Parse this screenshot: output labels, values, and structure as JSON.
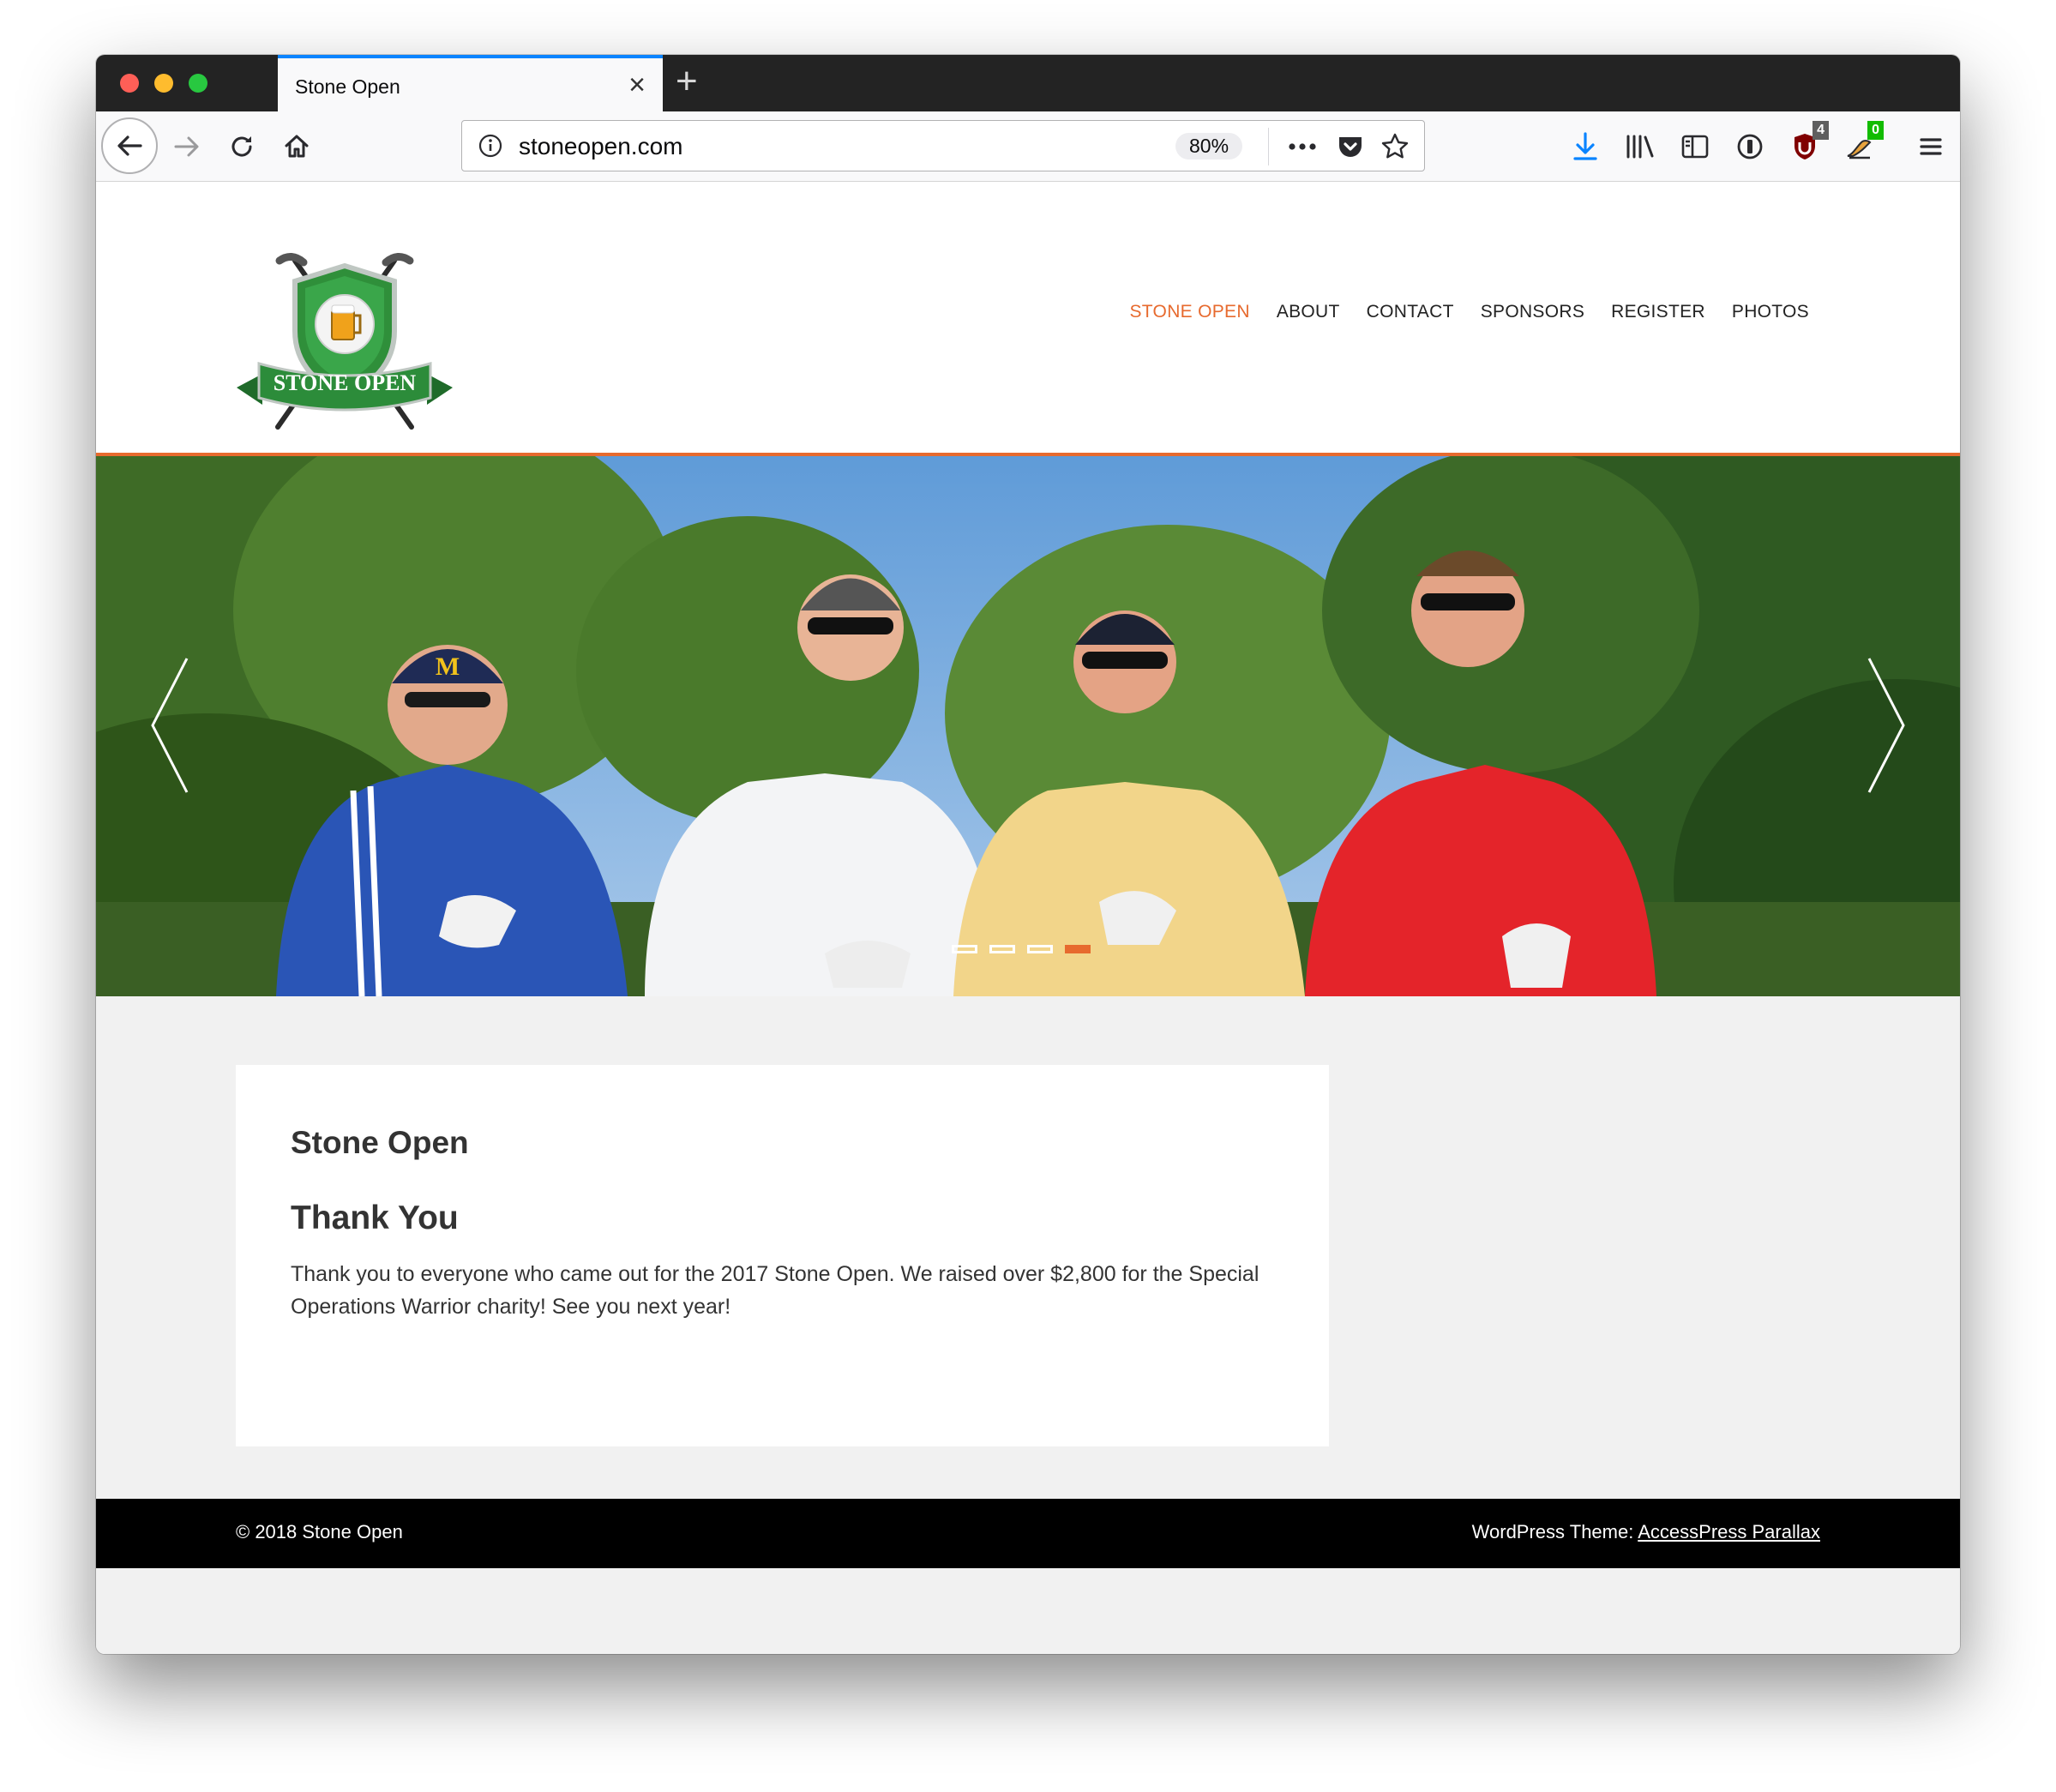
{
  "browser": {
    "tab": {
      "title": "Stone Open"
    },
    "url": "stoneopen.com",
    "zoom": "80%",
    "badges": {
      "ublock": "4",
      "extension": "0"
    }
  },
  "site": {
    "logo_text": "STONE OPEN",
    "nav": [
      "STONE OPEN",
      "ABOUT",
      "CONTACT",
      "SPONSORS",
      "REGISTER",
      "PHOTOS"
    ],
    "active_nav": "STONE OPEN",
    "slider": {
      "slide_count": 4,
      "active_slide": 4
    }
  },
  "content": {
    "title": "Stone Open",
    "heading": "Thank You",
    "body": "Thank you to everyone who came out for the 2017 Stone Open. We raised over $2,800 for the Special Operations Warrior charity!  See you next year!"
  },
  "footer": {
    "copyright": "© 2018 Stone Open",
    "credit_prefix": "WordPress Theme: ",
    "credit_link": "AccessPress Parallax"
  },
  "colors": {
    "accent": "#e76a2e",
    "footer_bg": "#000000",
    "page_bg": "#f1f1f1",
    "tab_indicator": "#0a84ff"
  },
  "icons": [
    "back-icon",
    "forward-icon",
    "reload-icon",
    "home-icon",
    "info-icon",
    "more-icon",
    "pocket-icon",
    "star-icon",
    "download-icon",
    "library-icon",
    "sidebar-icon",
    "password-icon",
    "ublock-icon",
    "extension-icon",
    "menu-icon",
    "prev-arrow-icon",
    "next-arrow-icon"
  ]
}
